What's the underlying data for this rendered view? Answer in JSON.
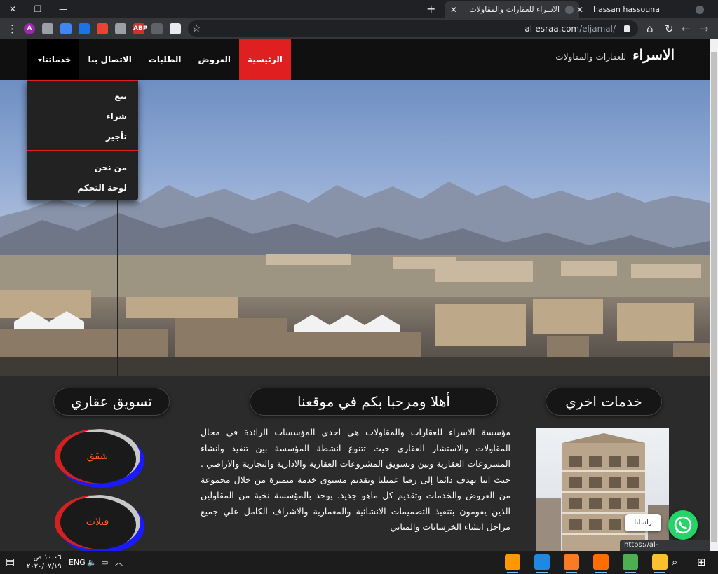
{
  "browser": {
    "tabs": [
      {
        "title": "الاسراء للعقارات والمقاولات",
        "active": true
      },
      {
        "title": "hassan hassouna",
        "active": false
      }
    ],
    "url_host": "al-esraa.com",
    "url_path": "/eljamal/",
    "status_url": "https://al-esraa.com/eljamal/#",
    "extensions": [
      {
        "icon": "profile-avatar-icon",
        "label": "A",
        "color": "#9c27b0"
      },
      {
        "icon": "puzzle-icon",
        "label": "",
        "color": "#9aa0a6"
      },
      {
        "icon": "extension-blue-icon",
        "label": "",
        "color": "#4285f4"
      },
      {
        "icon": "extension-grid-icon",
        "label": "",
        "color": "#1a73e8"
      },
      {
        "icon": "color-wheel-icon",
        "label": "",
        "color": "#ea4335"
      },
      {
        "icon": "camera-icon",
        "label": "",
        "color": "#9aa0a6"
      },
      {
        "icon": "adblock-icon",
        "label": "ABP",
        "color": "#d32f2f"
      },
      {
        "icon": "moon-icon",
        "label": "",
        "color": "#5f6368"
      },
      {
        "icon": "extension-circle-icon",
        "label": "",
        "color": "#e8eaed"
      }
    ]
  },
  "site": {
    "brand_main": "الاسراء",
    "brand_sub": "للعقارات والمقاولات",
    "nav": [
      {
        "label": "الرئيسية",
        "state": "active"
      },
      {
        "label": "العروض",
        "state": "normal"
      },
      {
        "label": "الطلبات",
        "state": "normal"
      },
      {
        "label": "الاتصال بنا",
        "state": "normal"
      },
      {
        "label": "خدماتنا",
        "state": "open"
      }
    ],
    "dropdown": [
      "بيع",
      "شراء",
      "تأجير",
      "من نحن",
      "لوحة التحكم"
    ],
    "headings": {
      "right": "خدمات اخري",
      "center": "أهلا ومرحبا بكم في موقعنا",
      "left": "تسويق عقاري"
    },
    "paragraph": "مؤسسة الاسراء للعقارات والمقاولات هي احدي المؤسسات الرائدة في مجال المقاولات والاستشار العقاري حيث تتنوع انشطة المؤسسة بين تنفيذ وانشاء المشروعات العقارية وبين وتسويق المشروعات العقارية والادارية والتجارية والاراضي . حيث اننا نهدف دائما إلى رضا عميلنا وتقديم مستوى خدمة متميزة من خلال مجموعة من العروض والخدمات وتقديم كل ماهو جديد. يوجد بالمؤسسة نخبة من المقاولين الذين يقومون بتنفيذ التصميمات الانشائية والمعمارية والاشراف الكامل علي جميع مراحل انشاء الخرسانات والمباني",
    "marketing_buttons": [
      "شقق",
      "فيلات"
    ],
    "whatsapp_label": "راسلنا"
  },
  "taskbar": {
    "time": "١٠:٠٦ ص",
    "date": "٢٠٢٠/٠٧/١٩",
    "language": "ENG",
    "apps": [
      {
        "icon": "sublime-text-icon",
        "color": "#ff9800",
        "running": true
      },
      {
        "icon": "vscode-icon",
        "color": "#1e88e5",
        "running": true
      },
      {
        "icon": "xampp-icon",
        "color": "#fb7a24",
        "running": true
      },
      {
        "icon": "firefox-icon",
        "color": "#ff6d00",
        "running": true
      },
      {
        "icon": "chrome-icon",
        "color": "#4caf50",
        "running": true
      },
      {
        "icon": "file-explorer-icon",
        "color": "#fbc02d",
        "running": true
      }
    ]
  }
}
